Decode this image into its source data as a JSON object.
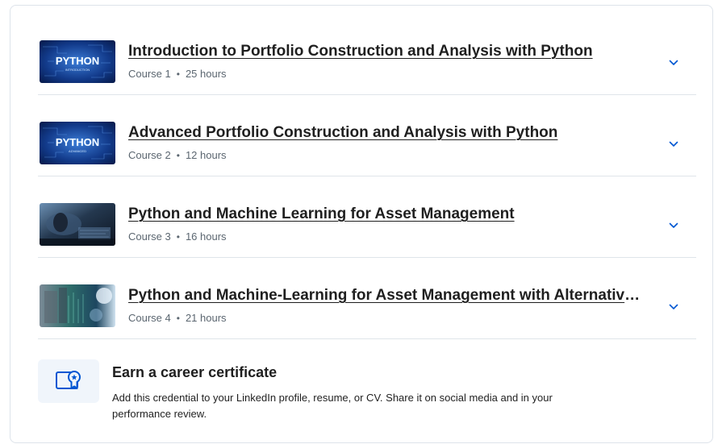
{
  "courses": [
    {
      "title": "Introduction to Portfolio Construction and Analysis with Python",
      "course_label": "Course 1",
      "duration": "25 hours",
      "thumbnail_text": "PYTHON",
      "thumbnail_subtext": "INTRODUCTION"
    },
    {
      "title": "Advanced Portfolio Construction and Analysis with Python",
      "course_label": "Course 2",
      "duration": "12 hours",
      "thumbnail_text": "PYTHON",
      "thumbnail_subtext": "ADVANCED"
    },
    {
      "title": "Python and Machine Learning for Asset Management",
      "course_label": "Course 3",
      "duration": "16 hours"
    },
    {
      "title": "Python and Machine-Learning for Asset Management with Alternative Data Sets",
      "course_label": "Course 4",
      "duration": "21 hours"
    }
  ],
  "separator": "•",
  "certificate": {
    "title": "Earn a career certificate",
    "description": "Add this credential to your LinkedIn profile, resume, or CV. Share it on social media and in your performance review."
  },
  "colors": {
    "chevron": "#0056d2",
    "accent_blue": "#0056d2",
    "cert_icon_bg": "#f0f5fb"
  }
}
